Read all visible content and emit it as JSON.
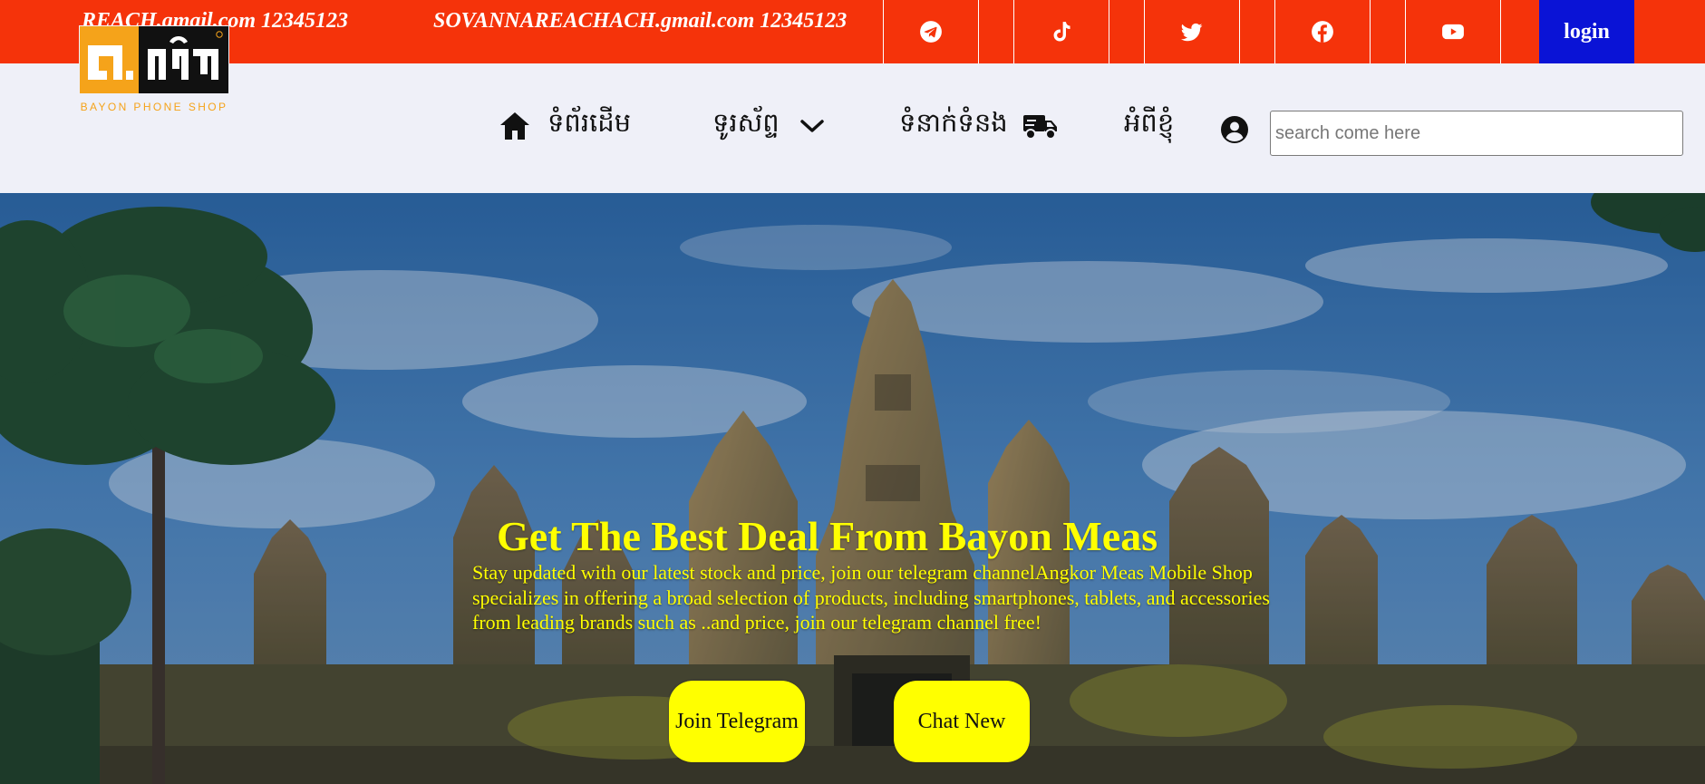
{
  "topbar": {
    "contact_1": "REACH.gmail.com 12345123",
    "contact_2": "SOVANNAREACHACH.gmail.com 12345123",
    "social_icons": [
      "telegram-icon",
      "tiktok-icon",
      "twitter-icon",
      "facebook-icon",
      "youtube-icon"
    ],
    "login_label": "login",
    "bar_color": "#f5330a",
    "login_color": "#0a13d6"
  },
  "logo": {
    "brand_glyphs": "បាយ័ន",
    "caption": "BAYON PHONE SHOP",
    "accent": "#f5a31a"
  },
  "nav": {
    "home": "ទំព័រដើម",
    "phones": "ទូរស័ព្ទ",
    "contact": "ទំនាក់ទំនង",
    "about": "អំពីខ្ញុំ",
    "search_placeholder": "search come here"
  },
  "hero": {
    "title": "Get The Best Deal From Bayon Meas",
    "text": "Stay updated with our latest stock and price, join our telegram channelAngkor Meas Mobile Shop specializes in offering a broad selection of products, including smartphones, tablets, and accessories from leading brands such as ..and price, join our telegram channel free!",
    "button_1": "Join Telegram",
    "button_2": "Chat New",
    "accent": "#ffff00"
  }
}
